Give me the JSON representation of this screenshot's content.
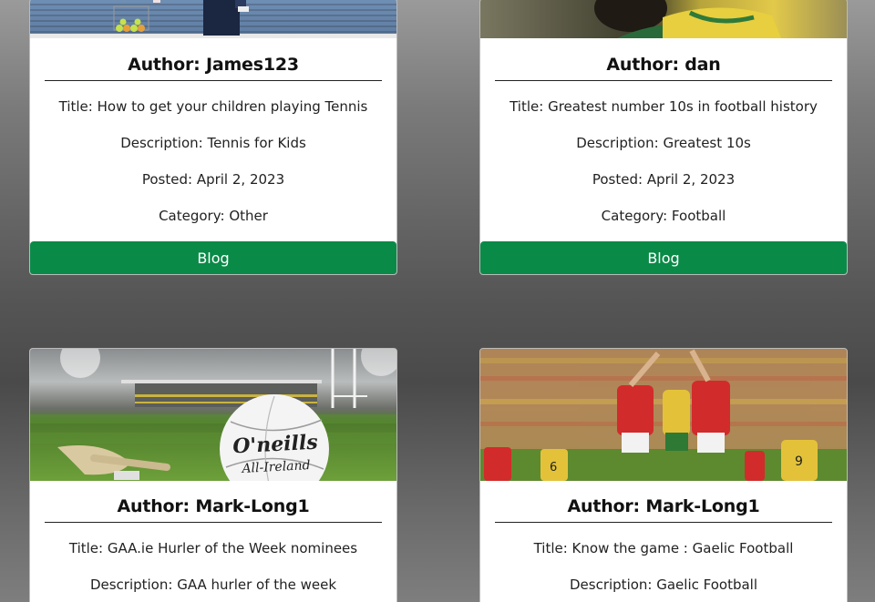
{
  "posts": [
    {
      "image_alt": "tennis-photo",
      "author": "Author: James123",
      "title": "Title: How to get your children playing Tennis",
      "description": "Description: Tennis for Kids",
      "posted": "Posted: April 2, 2023",
      "category": "Category: Other",
      "button": "Blog"
    },
    {
      "image_alt": "football-photo",
      "author": "Author: dan",
      "title": "Title: Greatest number 10s in football history",
      "description": "Description: Greatest 10s",
      "posted": "Posted: April 2, 2023",
      "category": "Category: Football",
      "button": "Blog"
    },
    {
      "image_alt": "hurling-photo",
      "author": "Author: Mark-Long1",
      "title": "Title: GAA.ie Hurler of the Week nominees",
      "description": "Description: GAA hurler of the week"
    },
    {
      "image_alt": "gaelic-football-photo",
      "author": "Author: Mark-Long1",
      "title": "Title: Know the game : Gaelic Football",
      "description": "Description: Gaelic Football"
    }
  ],
  "ball_brand": "O'neills",
  "ball_text": "All-Ireland",
  "colors": {
    "button": "#0a8a47",
    "card": "#ffffff"
  }
}
